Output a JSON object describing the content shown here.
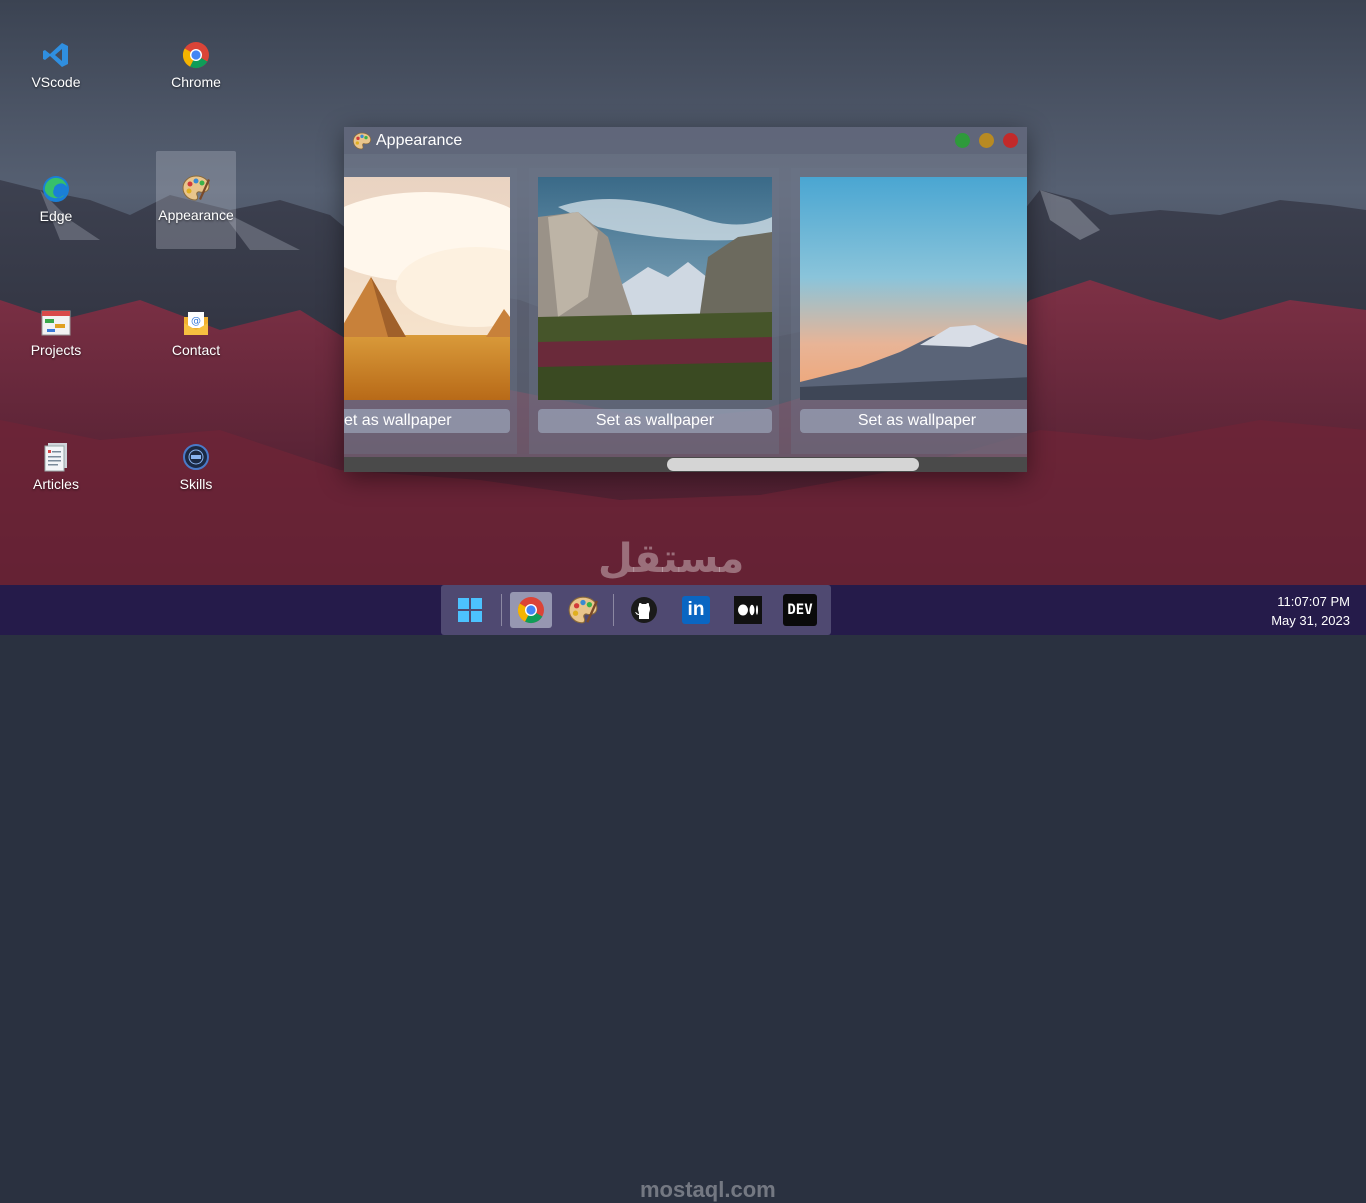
{
  "desktop": {
    "icons": [
      {
        "label": "VScode"
      },
      {
        "label": "Chrome"
      },
      {
        "label": "Edge"
      },
      {
        "label": "Appearance"
      },
      {
        "label": "Projects"
      },
      {
        "label": "Contact"
      },
      {
        "label": "Articles"
      },
      {
        "label": "Skills"
      }
    ]
  },
  "window": {
    "title": "Appearance",
    "wallpapers": [
      {
        "button_label": "et as wallpaper"
      },
      {
        "button_label": "Set as wallpaper"
      },
      {
        "button_label": "Set as wallpaper"
      }
    ]
  },
  "taskbar": {
    "items": [
      {
        "icon": "windows-start-icon"
      },
      {
        "icon": "chrome-icon"
      },
      {
        "icon": "appearance-palette-icon"
      },
      {
        "icon": "github-icon"
      },
      {
        "icon": "linkedin-icon",
        "text": "in"
      },
      {
        "icon": "medium-icon"
      },
      {
        "icon": "dev-icon",
        "text": "DEV"
      }
    ],
    "clock": {
      "time": "11:07:07 PM",
      "date": "May 31, 2023"
    }
  },
  "watermark": {
    "arabic": "مستقل",
    "latin": "mostaql.com"
  },
  "colors": {
    "taskbar": "#251b4a",
    "close": "#c22a2a",
    "minimize": "#b88a22",
    "maximize": "#2e9a3b"
  }
}
